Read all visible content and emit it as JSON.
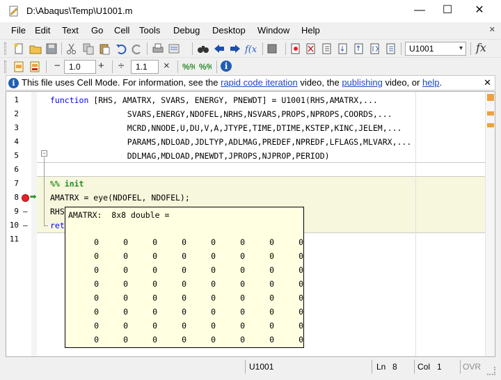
{
  "window": {
    "title": "D:\\Abaqus\\Temp\\U1001.m",
    "minimize": "—",
    "maximize": "☐",
    "close": "✕"
  },
  "menu": {
    "items": [
      "File",
      "Edit",
      "Text",
      "Go",
      "Cell",
      "Tools",
      "Debug",
      "Desktop",
      "Window",
      "Help"
    ],
    "close_glyph": "✕"
  },
  "toolbar": {
    "function_combo": "U1001",
    "combo_arrow": "▾",
    "fx_label": "fx"
  },
  "cell_toolbar": {
    "minus": "−",
    "step_value": "1.0",
    "plus": "+",
    "divide": "÷",
    "divide_value": "1.1",
    "times": "×"
  },
  "infobar": {
    "prefix": "This file uses Cell Mode. For information, see the ",
    "link1": "rapid code iteration",
    "mid1": " video, the ",
    "link2": "publishing",
    "mid2": " video, or ",
    "link3": "help",
    "suffix": ".",
    "close": "✕"
  },
  "editor": {
    "lines": [
      {
        "n": "1",
        "marker": "",
        "text": "function [RHS, AMATRX, SVARS, ENERGY, PNEWDT] = U1001(RHS,AMATRX,..."
      },
      {
        "n": "2",
        "marker": "",
        "text": "                SVARS,ENERGY,NDOFEL,NRHS,NSVARS,PROPS,NPROPS,COORDS,..."
      },
      {
        "n": "3",
        "marker": "",
        "text": "                MCRD,NNODE,U,DU,V,A,JTYPE,TIME,DTIME,KSTEP,KINC,JELEM,..."
      },
      {
        "n": "4",
        "marker": "",
        "text": "                PARAMS,NDLOAD,JDLTYP,ADLMAG,PREDEF,NPREDF,LFLAGS,MLVARX,..."
      },
      {
        "n": "5",
        "marker": "",
        "text": "                DDLMAG,MDLOAD,PNEWDT,JPROPS,NJPROP,PERIOD)"
      },
      {
        "n": "6",
        "marker": "",
        "text": ""
      },
      {
        "n": "7",
        "marker": "",
        "text": "%% init"
      },
      {
        "n": "8",
        "marker": "",
        "text": "AMATRX = eye(NDOFEL, NDOFEL);"
      },
      {
        "n": "9",
        "marker": "—",
        "text": "RHS"
      },
      {
        "n": "10",
        "marker": "—",
        "text": "ret"
      },
      {
        "n": "11",
        "marker": "",
        "text": ""
      }
    ],
    "keyword": "function",
    "fold_glyph": "−",
    "current_line_arrow": "➡"
  },
  "datatip": {
    "header": "AMATRX:  8x8 double =",
    "rows": [
      [
        "0",
        "0",
        "0",
        "0",
        "0",
        "0",
        "0",
        "0"
      ],
      [
        "0",
        "0",
        "0",
        "0",
        "0",
        "0",
        "0",
        "0"
      ],
      [
        "0",
        "0",
        "0",
        "0",
        "0",
        "0",
        "0",
        "0"
      ],
      [
        "0",
        "0",
        "0",
        "0",
        "0",
        "0",
        "0",
        "0"
      ],
      [
        "0",
        "0",
        "0",
        "0",
        "0",
        "0",
        "0",
        "0"
      ],
      [
        "0",
        "0",
        "0",
        "0",
        "0",
        "0",
        "0",
        "0"
      ],
      [
        "0",
        "0",
        "0",
        "0",
        "0",
        "0",
        "0",
        "0"
      ],
      [
        "0",
        "0",
        "0",
        "0",
        "0",
        "0",
        "0",
        "0"
      ]
    ]
  },
  "status": {
    "function": "U1001",
    "ln_label": "Ln",
    "ln_value": "8",
    "col_label": "Col",
    "col_value": "1",
    "ovr": "OVR"
  },
  "colors": {
    "keyword": "#0000ff",
    "cell_title": "#228b22",
    "cell_band": "#f7f7dd",
    "link": "#1a47c8",
    "breakpoint": "#e8202a"
  }
}
